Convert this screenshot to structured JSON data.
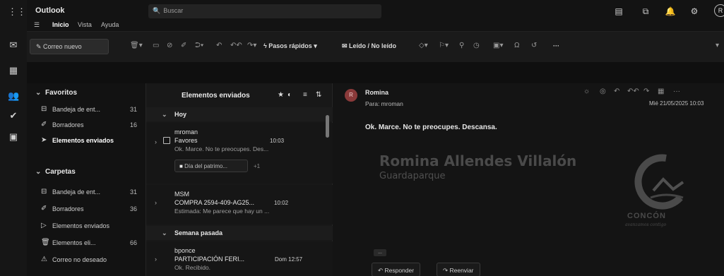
{
  "app": {
    "title": "Outlook",
    "search_placeholder": "Buscar",
    "user_initial": "R"
  },
  "menu": [
    "Inicio",
    "Vista",
    "Ayuda"
  ],
  "ribbon": {
    "new_mail": "Correo nuevo",
    "quick_steps": "Pasos rápidos",
    "read_unread": "Leído / No leído",
    "more": "···"
  },
  "folders": {
    "favorites_label": "Favoritos",
    "favorites": [
      {
        "label": "Bandeja de ent...",
        "count": "31",
        "icon": "inbox-icon"
      },
      {
        "label": "Borradores",
        "count": "16",
        "icon": "draft-icon"
      },
      {
        "label": "Elementos enviados",
        "count": "",
        "icon": "sent-icon"
      }
    ],
    "folders_label": "Carpetas",
    "folders": [
      {
        "label": "Bandeja de ent...",
        "count": "31",
        "icon": "inbox-icon"
      },
      {
        "label": "Borradores",
        "count": "36",
        "icon": "draft-icon"
      },
      {
        "label": "Elementos enviados",
        "count": "",
        "icon": "sent-icon"
      },
      {
        "label": "Elementos eli...",
        "count": "66",
        "icon": "trash-icon"
      },
      {
        "label": "Correo no deseado",
        "count": "",
        "icon": "junk-icon"
      }
    ]
  },
  "list": {
    "title": "Elementos enviados",
    "groups": [
      "Hoy",
      "Semana pasada"
    ],
    "messages": [
      {
        "from": "mroman",
        "subject": "Favores",
        "time": "10:03",
        "preview": "Ok. Marce. No te preocupes. Des...",
        "attachment": "Día del patrimo...",
        "attachment_extra": "+1"
      },
      {
        "from": "MSM",
        "subject": "COMPRA 2594-409-AG25...",
        "time": "10:02",
        "preview": "Estimada: Me parece que hay un ..."
      },
      {
        "from": "bponce",
        "subject": "PARTICIPACIÓN FERI...",
        "time": "Dom 12:57",
        "preview": "Ok. Recibido."
      }
    ]
  },
  "reader": {
    "avatar": "R",
    "sender": "Romina",
    "to": "Para: mroman",
    "date": "Mié 21/05/2025 10:03",
    "body": "Ok. Marce. No te preocupes. Descansa.",
    "signature_name": "Romina Allendes Villalón",
    "signature_role": "Guardaparque",
    "logo_word": "CONCÓN",
    "logo_tag": "avanzamos contigo",
    "reply": "Responder",
    "forward": "Reenviar",
    "collapsed": "..."
  },
  "colors": {
    "background": "#0f0f0f",
    "pane": "#181818",
    "text": "#d8d8d8",
    "avatar": "#8a3a3a"
  }
}
